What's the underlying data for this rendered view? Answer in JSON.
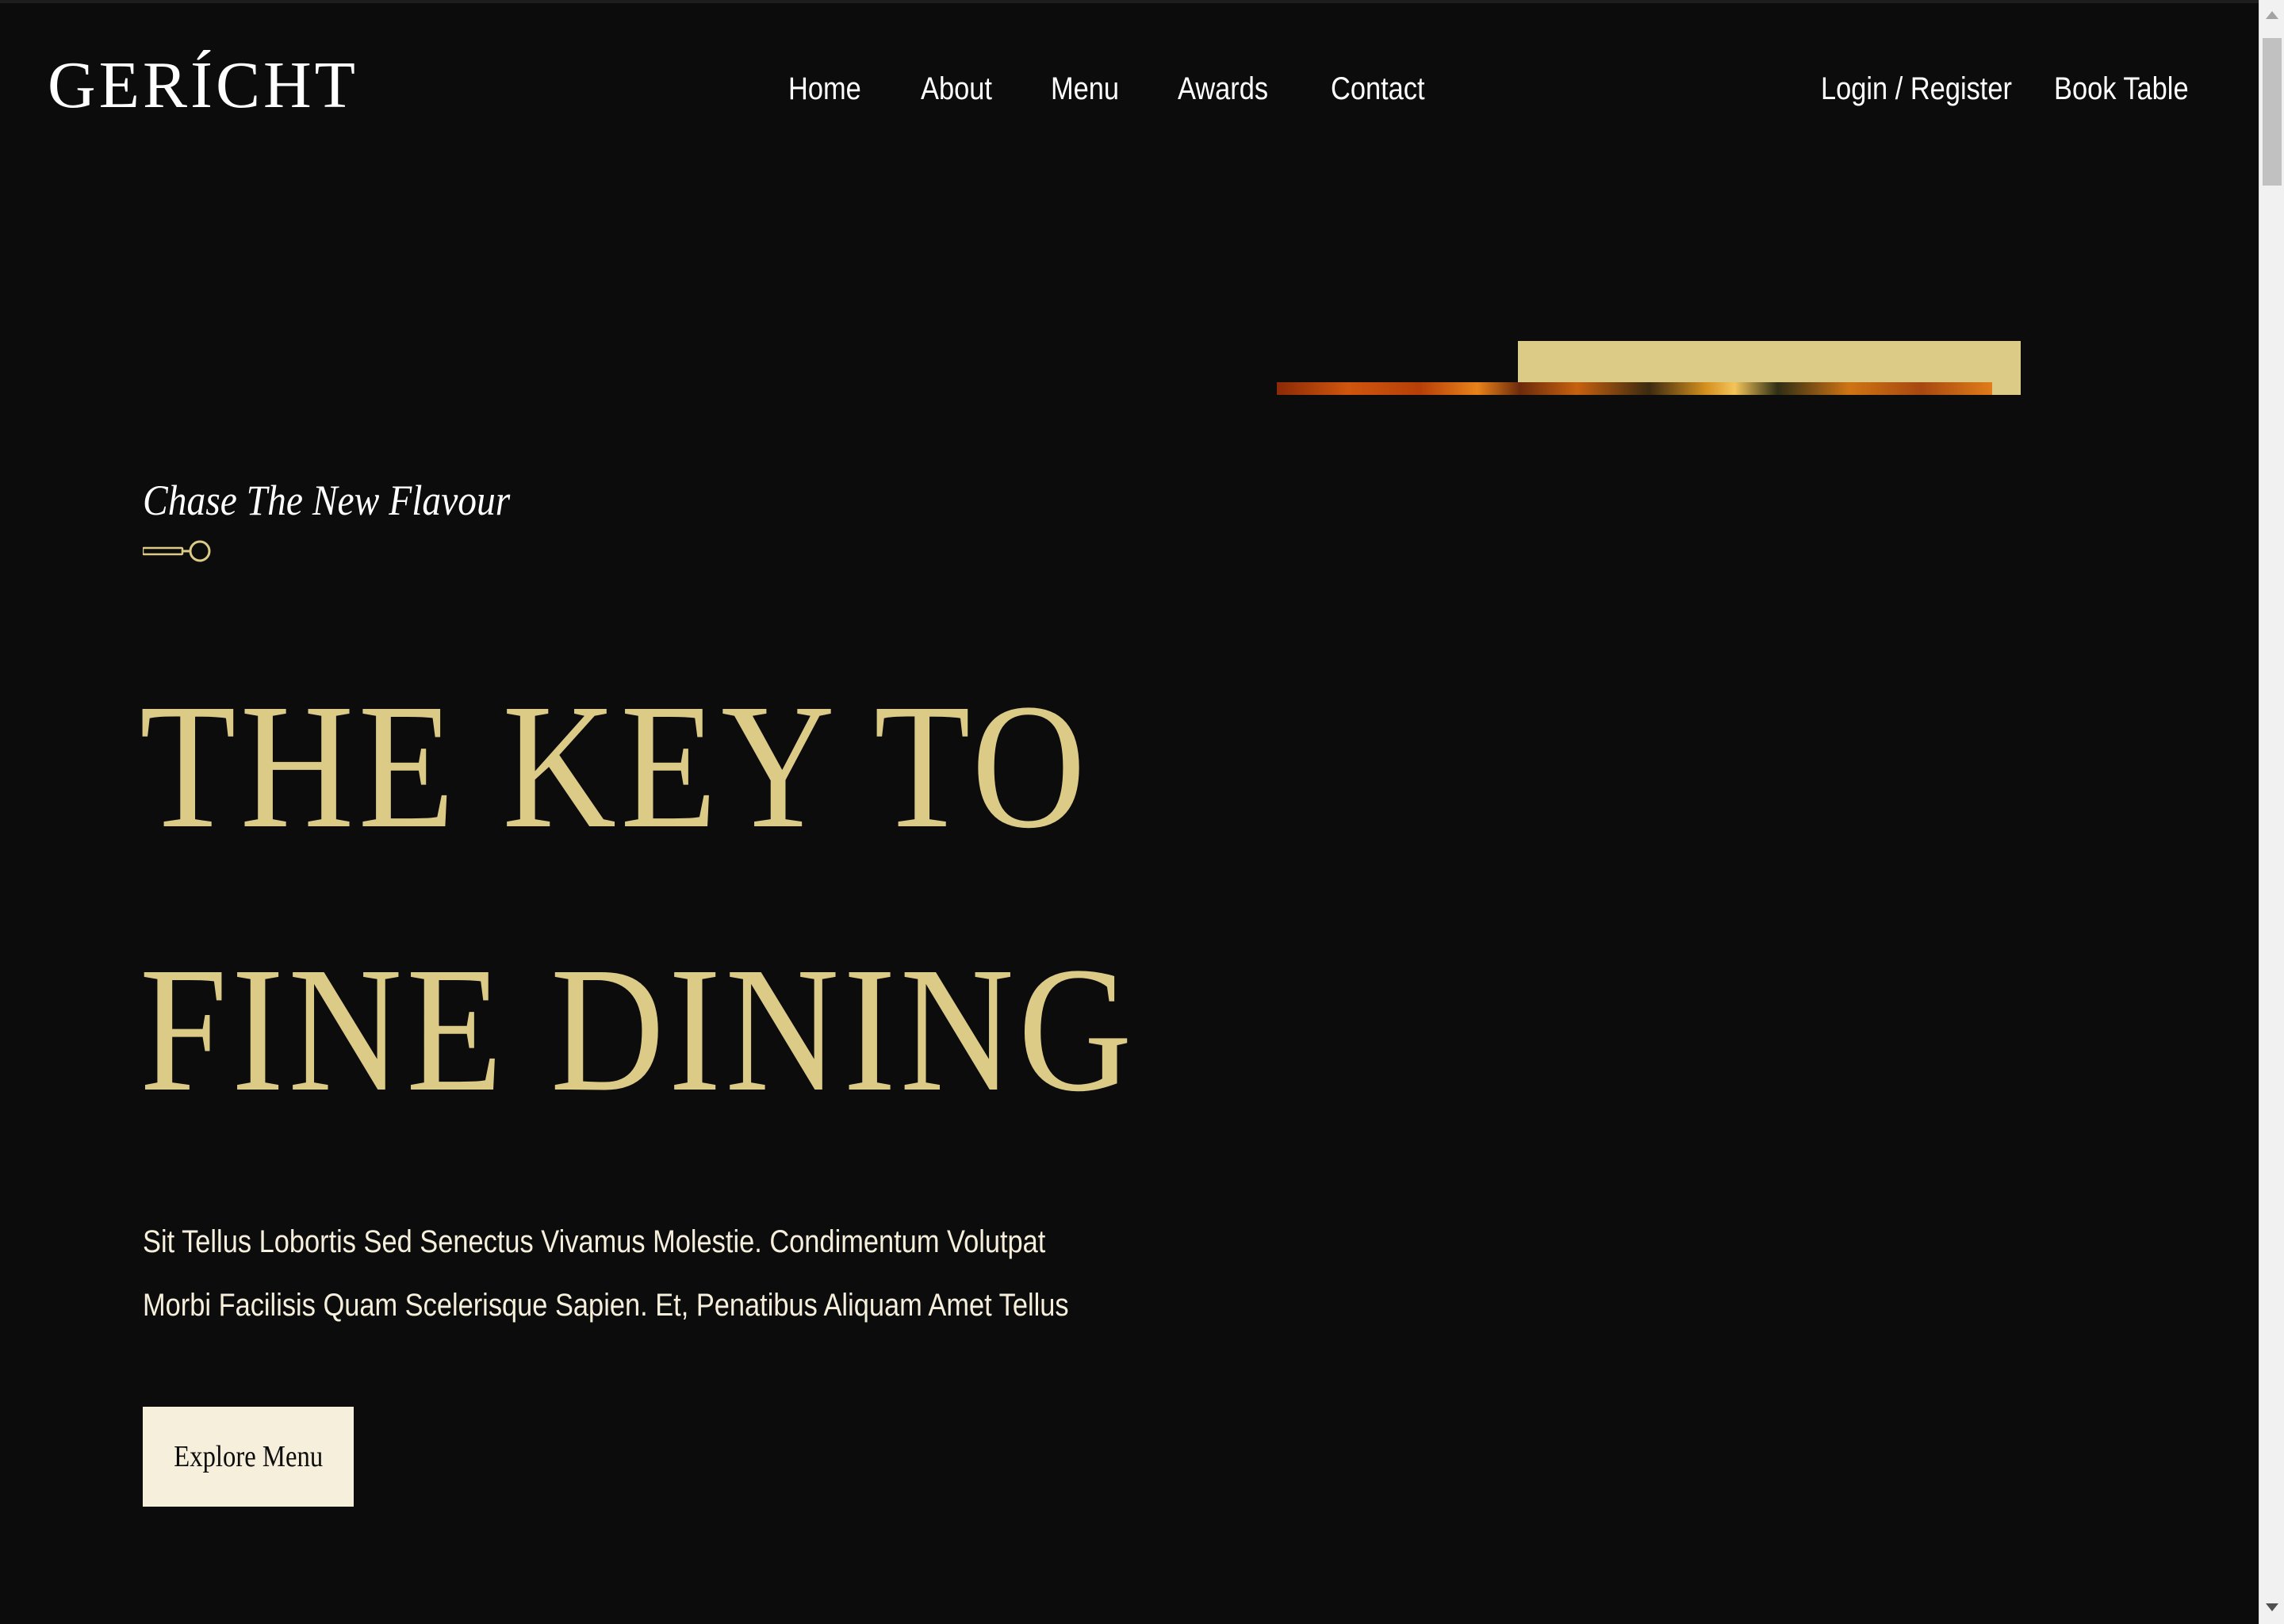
{
  "navbar": {
    "logo": "GERÍCHT",
    "links": [
      "Home",
      "About",
      "Menu",
      "Awards",
      "Contact"
    ],
    "login_label": "Login / Register",
    "book_label": "Book Table"
  },
  "hero": {
    "subtitle": "Chase The New Flavour",
    "headline_line1": "THE KEY TO",
    "headline_line2": "FINE DINING",
    "description_line1": "Sit Tellus Lobortis Sed Senectus Vivamus Molestie. Condimentum Volutpat",
    "description_line2": "Morbi Facilisis Quam Scelerisque Sapien. Et, Penatibus Aliquam Amet Tellus",
    "cta_label": "Explore Menu"
  },
  "colors": {
    "background": "#0c0c0c",
    "gold": "#dcca87",
    "cream": "#f5efdb",
    "white": "#ffffff"
  },
  "icons": {
    "spoon": "spoon-divider-icon",
    "scroll_up": "chevron-up-icon",
    "scroll_down": "chevron-down-icon"
  }
}
